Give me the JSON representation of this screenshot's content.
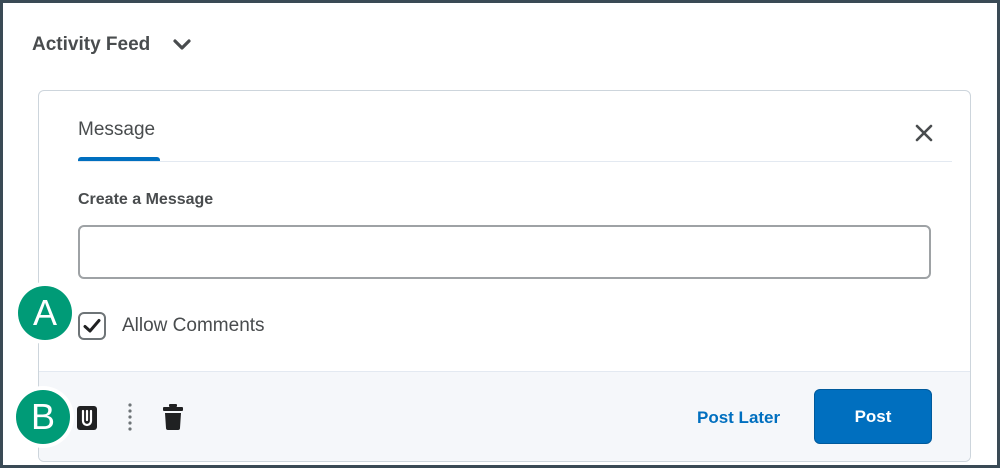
{
  "header": {
    "title": "Activity Feed",
    "chevron_icon": "chevron-down-icon"
  },
  "composer": {
    "tab_label": "Message",
    "close_icon": "close-icon",
    "field_label": "Create a Message",
    "message_value": "",
    "allow_comments": {
      "label": "Allow Comments",
      "checked": true
    },
    "toolbar": {
      "attach_icon": "paperclip-icon",
      "more_icon": "more-vertical-icon",
      "delete_icon": "trash-icon"
    },
    "post_later_label": "Post Later",
    "post_label": "Post"
  },
  "callouts": {
    "a": "A",
    "b": "B"
  },
  "colors": {
    "accent": "#006fbf",
    "callout": "#009b77",
    "frame": "#3a4a55"
  }
}
